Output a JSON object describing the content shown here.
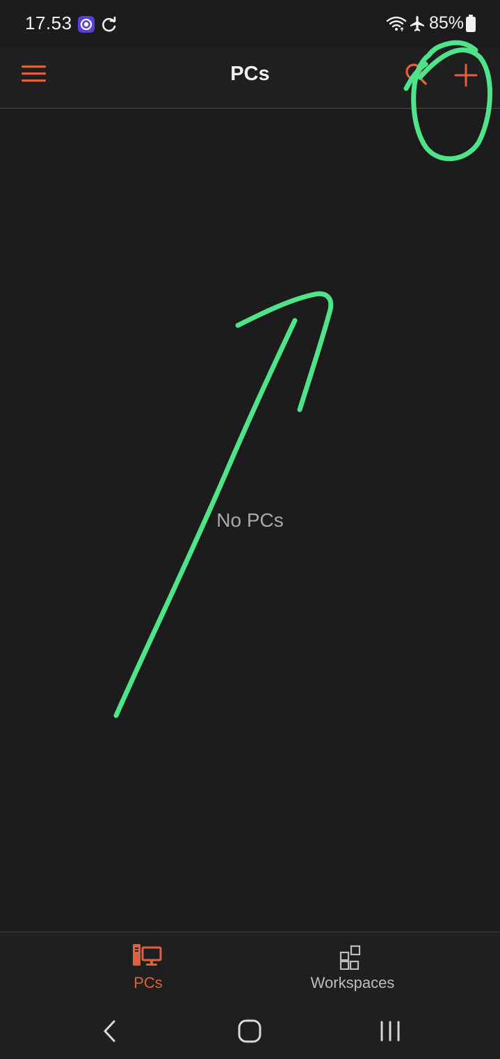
{
  "status_bar": {
    "time": "17.53",
    "battery": "85%",
    "icons": [
      "app-notification-icon",
      "sync-icon",
      "wifi-icon",
      "airplane-mode-icon",
      "battery-icon"
    ]
  },
  "app_bar": {
    "title": "PCs",
    "menu_icon": "hamburger-menu-icon",
    "search_icon": "search-icon",
    "add_icon": "plus-icon"
  },
  "main": {
    "empty_message": "No PCs"
  },
  "bottom_nav": {
    "items": [
      {
        "label": "PCs",
        "icon": "pc-monitor-icon",
        "active": true
      },
      {
        "label": "Workspaces",
        "icon": "workspaces-grid-icon",
        "active": false
      }
    ]
  },
  "system_nav": {
    "buttons": [
      "back-icon",
      "home-icon",
      "recent-apps-icon"
    ]
  },
  "colors": {
    "background": "#1c1c1c",
    "accent": "#e0603f",
    "annotation": "#4fe38a",
    "text_primary": "#f1f1f1",
    "text_secondary": "#a9a9a9",
    "inactive_icon": "#bdbdbd"
  }
}
